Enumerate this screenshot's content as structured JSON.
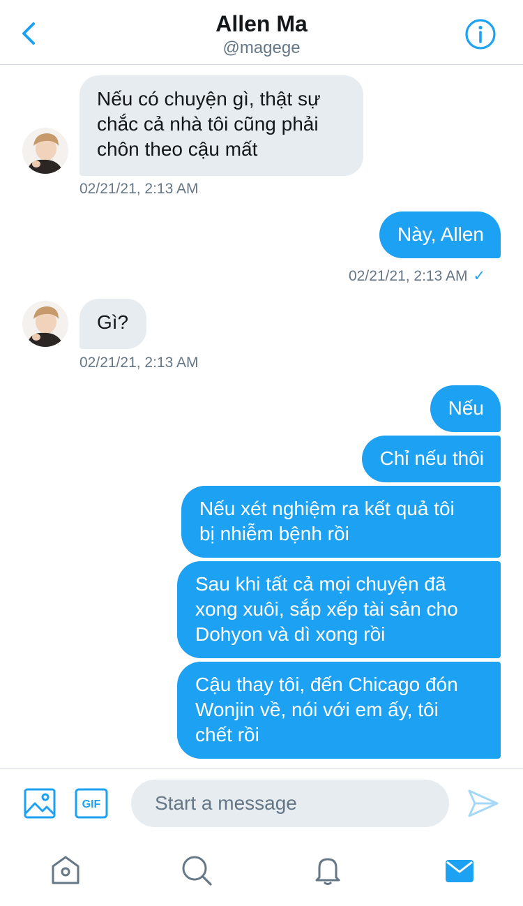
{
  "header": {
    "title": "Allen Ma",
    "handle": "@magege",
    "back_icon": "chevron-left-icon",
    "info_icon": "info-icon",
    "accent_color": "#1da1f2"
  },
  "messages": [
    {
      "direction": "incoming",
      "text": "Nếu có chuyện gì, thật sự\nchắc cả nhà tôi cũng phải\nchôn theo cậu mất",
      "timestamp": "02/21/21, 2:13 AM"
    },
    {
      "direction": "outgoing",
      "text": "Này, Allen",
      "timestamp": "02/21/21, 2:13 AM",
      "read_check": "✓"
    },
    {
      "direction": "incoming",
      "text": "Gì?",
      "timestamp": "02/21/21, 2:13 AM"
    },
    {
      "direction": "outgoing",
      "text": "Nếu"
    },
    {
      "direction": "outgoing",
      "text": "Chỉ nếu thôi"
    },
    {
      "direction": "outgoing",
      "text": "Nếu xét nghiệm ra kết quả tôi\nbị nhiễm bệnh rồi"
    },
    {
      "direction": "outgoing",
      "text": "Sau khi tất cả mọi chuyện đã\nxong xuôi, sắp xếp tài sản cho\nDohyon và dì xong rồi"
    },
    {
      "direction": "outgoing",
      "text": "Cậu thay tôi, đến Chicago đón\nWonjin về, nói với em ấy, tôi\nchết rồi"
    }
  ],
  "composer": {
    "placeholder": "Start a message",
    "value": "",
    "image_icon": "image-icon",
    "gif_label": "GIF",
    "send_icon": "send-icon"
  },
  "tabbar": {
    "items": [
      "home-icon",
      "search-icon",
      "notifications-bell-icon",
      "messages-envelope-icon"
    ],
    "active": "messages-envelope-icon"
  },
  "colors": {
    "outgoing_bubble": "#1da1f2",
    "incoming_bubble": "#e6ecf0",
    "secondary_text": "#657786"
  }
}
